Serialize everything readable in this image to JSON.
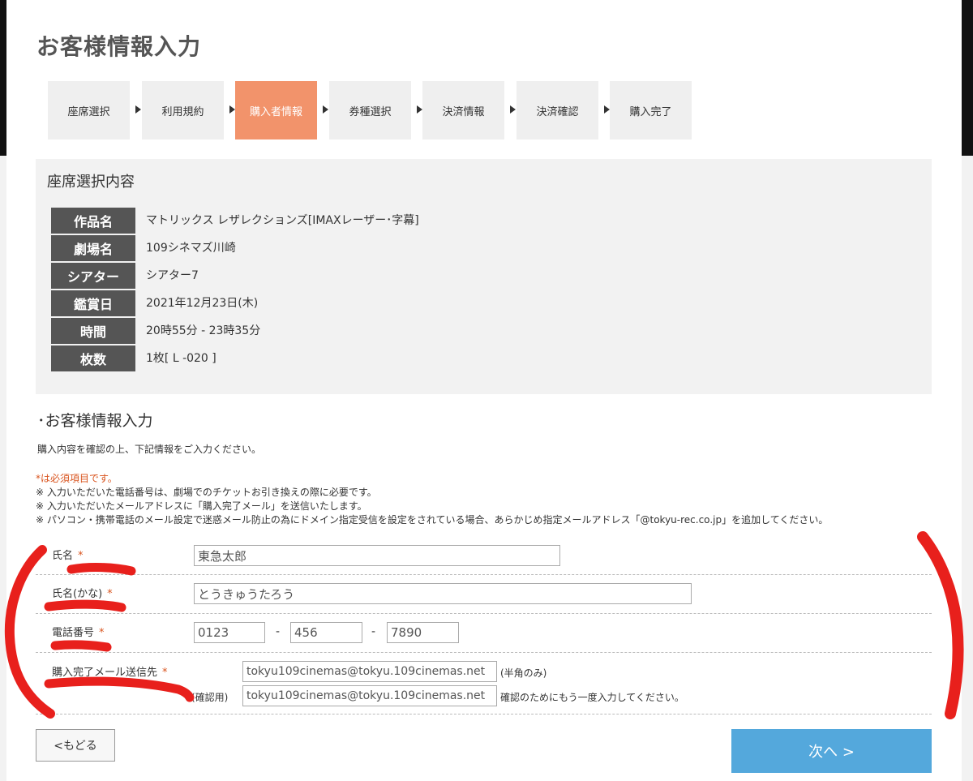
{
  "page_title": "お客様情報入力",
  "steps": [
    "座席選択",
    "利用規約",
    "購入者情報",
    "券種選択",
    "決済情報",
    "決済確認",
    "購入完了"
  ],
  "active_step": "購入者情報",
  "summary": {
    "title": "座席選択内容",
    "rows": [
      {
        "label": "作品名",
        "value": "マトリックス レザレクションズ[IMAXレーザー･字幕]"
      },
      {
        "label": "劇場名",
        "value": "109シネマズ川崎"
      },
      {
        "label": "シアター",
        "value": "シアター7"
      },
      {
        "label": "鑑賞日",
        "value": "2021年12月23日(木)"
      },
      {
        "label": "時間",
        "value": "20時55分 - 23時35分"
      },
      {
        "label": "枚数",
        "value": "1枚[ L -020 ]"
      }
    ]
  },
  "form": {
    "section_title": "･お客様情報入力",
    "intro": "購入内容を確認の上、下記情報をご入力ください。",
    "required_note": "*は必須項目です。",
    "notes": [
      "※ 入力いただいた電話番号は、劇場でのチケットお引き換えの際に必要です。",
      "※ 入力いただいたメールアドレスに「購入完了メール」を送信いたします。",
      "※ パソコン・携帯電話のメール設定で迷惑メール防止の為にドメイン指定受信を設定をされている場合、あらかじめ指定メールアドレス「@tokyu-rec.co.jp」を追加してください。"
    ],
    "required_mark": "*",
    "name_label": "氏名",
    "name_value": "東急太郎",
    "kana_label": "氏名(かな)",
    "kana_value": "とうきゅうたろう",
    "phone_label": "電話番号",
    "phone_1": "0123",
    "phone_2": "456",
    "phone_3": "7890",
    "phone_sep": "-",
    "email_label": "購入完了メール送信先",
    "email_value": "tokyu109cinemas@tokyu.109cinemas.net",
    "email_hint": "(半角のみ)",
    "confirm_label": "(確認用)",
    "confirm_value": "tokyu109cinemas@tokyu.109cinemas.net",
    "confirm_hint": "確認のためにもう一度入力してください。"
  },
  "buttons": {
    "back": "<もどる",
    "next": "次へ >"
  },
  "colors": {
    "active_step": "#f2936b",
    "label_bg": "#555555",
    "required": "#d9541e",
    "next_button": "#54a8dc",
    "annotation": "#e8201c"
  }
}
